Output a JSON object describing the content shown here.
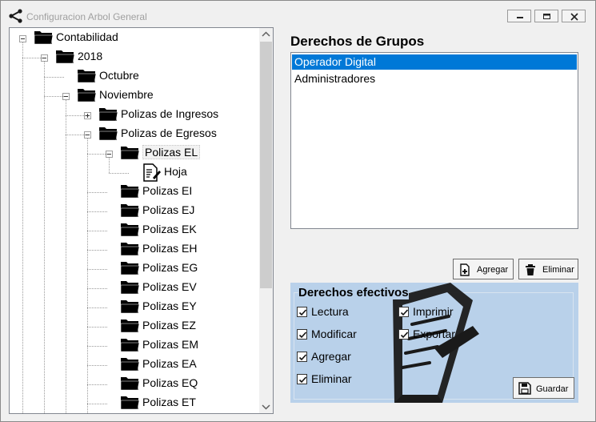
{
  "window": {
    "title": "Configuracion Arbol General",
    "controls": [
      "minimize-icon",
      "maximize-icon",
      "close-icon"
    ]
  },
  "tree": {
    "nodes": [
      {
        "label": "Contabilidad",
        "level": 0,
        "expander": "minus"
      },
      {
        "label": "2018",
        "level": 1,
        "expander": "minus"
      },
      {
        "label": "Octubre",
        "level": 2,
        "expander": "none"
      },
      {
        "label": "Noviembre",
        "level": 2,
        "expander": "minus"
      },
      {
        "label": "Polizas de Ingresos",
        "level": 3,
        "expander": "plus"
      },
      {
        "label": "Polizas de Egresos",
        "level": 3,
        "expander": "minus"
      },
      {
        "label": "Polizas EL",
        "level": 4,
        "expander": "minus",
        "selected": true
      },
      {
        "label": "Hoja",
        "level": 5,
        "expander": "none",
        "icon": "document-icon"
      },
      {
        "label": "Polizas EI",
        "level": 4,
        "expander": "none"
      },
      {
        "label": "Polizas EJ",
        "level": 4,
        "expander": "none"
      },
      {
        "label": "Polizas EK",
        "level": 4,
        "expander": "none"
      },
      {
        "label": "Polizas EH",
        "level": 4,
        "expander": "none"
      },
      {
        "label": "Polizas EG",
        "level": 4,
        "expander": "none"
      },
      {
        "label": "Polizas EV",
        "level": 4,
        "expander": "none"
      },
      {
        "label": "Polizas EY",
        "level": 4,
        "expander": "none"
      },
      {
        "label": "Polizas EZ",
        "level": 4,
        "expander": "none"
      },
      {
        "label": "Polizas EM",
        "level": 4,
        "expander": "none"
      },
      {
        "label": "Polizas EA",
        "level": 4,
        "expander": "none"
      },
      {
        "label": "Polizas EQ",
        "level": 4,
        "expander": "none"
      },
      {
        "label": "Polizas ET",
        "level": 4,
        "expander": "none"
      }
    ]
  },
  "groups": {
    "title": "Derechos de Grupos",
    "items": [
      {
        "label": "Operador Digital",
        "selected": true
      },
      {
        "label": "Administradores",
        "selected": false
      }
    ],
    "add_label": "Agregar",
    "delete_label": "Eliminar"
  },
  "effective": {
    "title": "Derechos efectivos",
    "checks": [
      {
        "label": "Lectura",
        "checked": true
      },
      {
        "label": "Imprimir",
        "checked": true
      },
      {
        "label": "Modificar",
        "checked": true
      },
      {
        "label": "Exportar",
        "checked": true
      },
      {
        "label": "Agregar",
        "checked": true
      },
      {
        "label": "Eliminar",
        "checked": true
      }
    ],
    "save_label": "Guardar"
  },
  "colors": {
    "selection": "#0078d7",
    "panel": "#b9d1ea",
    "window": "#f0f0f0"
  }
}
